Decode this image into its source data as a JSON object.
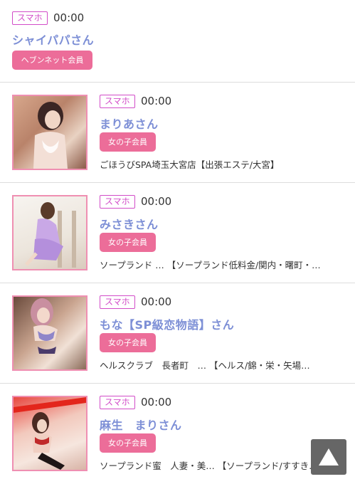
{
  "entries": [
    {
      "badge": "スマホ",
      "time": "00:00",
      "name": "シャイパパさん",
      "member": "ヘブンネット会員"
    },
    {
      "badge": "スマホ",
      "time": "00:00",
      "name": "まりあさん",
      "member": "女の子会員",
      "shop": "ごほうびSPA埼玉大宮店【出張エステ/大宮】",
      "photo_icon": "woman-photo"
    },
    {
      "badge": "スマホ",
      "time": "00:00",
      "name": "みさきさん",
      "member": "女の子会員",
      "shop": "ソープランド … 【ソープランド低料金/関内・曙町・…",
      "photo_icon": "woman-photo"
    },
    {
      "badge": "スマホ",
      "time": "00:00",
      "name": "もな【SP級恋物語】さん",
      "member": "女の子会員",
      "shop": "ヘルスクラブ　長者町　… 【ヘルス/錦・栄・矢場…",
      "photo_icon": "woman-photo"
    },
    {
      "badge": "スマホ",
      "time": "00:00",
      "name": "麻生　まりさん",
      "member": "女の子会員",
      "shop": "ソープランド蜜　人妻・美… 【ソープランド/すすき…",
      "photo_icon": "woman-photo"
    }
  ],
  "scroll_top_icon": "triangle-up-icon",
  "colors": {
    "badge": "#d24cc8",
    "name": "#7d8fd6",
    "member_bg": "#ec6d99",
    "photo_border": "#ef8fb2"
  }
}
